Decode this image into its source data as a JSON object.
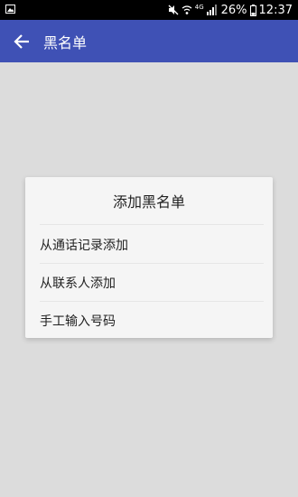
{
  "status_bar": {
    "battery": "26%",
    "time": "12:37",
    "network": "4G"
  },
  "app_bar": {
    "title": "黑名单",
    "accent_color": "#3f51b5"
  },
  "dialog": {
    "title": "添加黑名单",
    "options": [
      {
        "label": "从通话记录添加"
      },
      {
        "label": "从联系人添加"
      },
      {
        "label": "手工输入号码"
      }
    ]
  },
  "icons": [
    "gallery-icon",
    "mute-icon",
    "wifi-icon",
    "signal-icon",
    "battery-icon",
    "back-arrow-icon"
  ]
}
